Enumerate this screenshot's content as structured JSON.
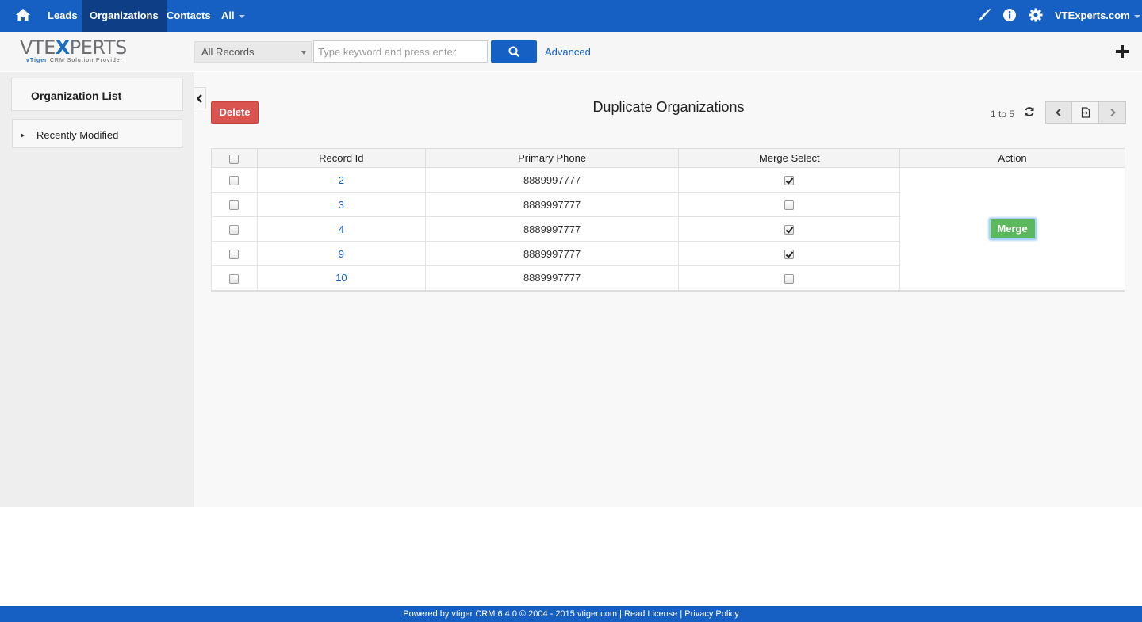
{
  "topnav": {
    "items": [
      {
        "label": "Leads"
      },
      {
        "label": "Organizations",
        "active": true
      },
      {
        "label": "Contacts"
      },
      {
        "label": "All"
      }
    ],
    "user": "VTExperts.com",
    "icons": [
      "home-icon",
      "paintbrush-icon",
      "info-icon",
      "gear-icon"
    ]
  },
  "logo": {
    "main_left": "VTE",
    "main_x": "X",
    "main_right": "PERTS",
    "tag_brand": "vTiger",
    "tag_rest": " CRM Solution Provider"
  },
  "search": {
    "filter_value": "All Records",
    "placeholder": "Type keyword and press enter",
    "advanced_label": "Advanced"
  },
  "sidebar": {
    "title": "Organization List",
    "items": [
      {
        "label": "Recently Modified"
      }
    ]
  },
  "main": {
    "delete_label": "Delete",
    "title": "Duplicate Organizations",
    "range": "1 to 5",
    "columns": [
      "Record Id",
      "Primary Phone",
      "Merge Select",
      "Action"
    ],
    "rows": [
      {
        "record_id": "2",
        "phone": "8889997777",
        "merge_selected": true
      },
      {
        "record_id": "3",
        "phone": "8889997777",
        "merge_selected": false
      },
      {
        "record_id": "4",
        "phone": "8889997777",
        "merge_selected": true
      },
      {
        "record_id": "9",
        "phone": "8889997777",
        "merge_selected": true
      },
      {
        "record_id": "10",
        "phone": "8889997777",
        "merge_selected": false
      }
    ],
    "merge_label": "Merge"
  },
  "footer": {
    "text": "Powered by vtiger CRM 6.4.0  © 2004 - 2015  vtiger.com | Read License | Privacy Policy"
  },
  "colors": {
    "brand": "#1760c3",
    "delete": "#d9534f",
    "merge": "#5cb85c"
  }
}
